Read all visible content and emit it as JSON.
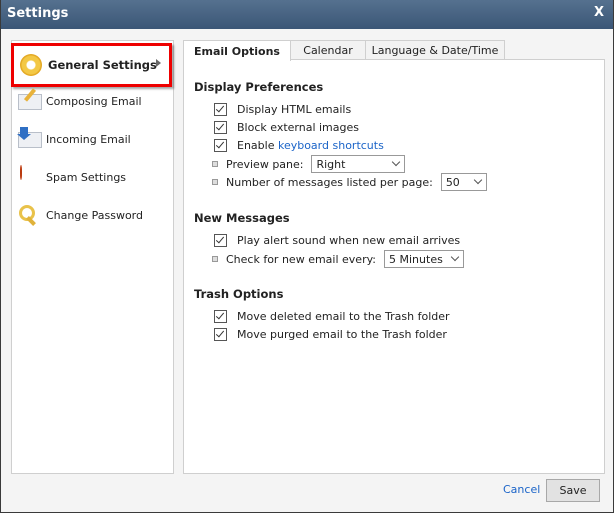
{
  "window": {
    "title": "Settings",
    "close_label": "X"
  },
  "sidebar": {
    "items": [
      {
        "label": "General Settings",
        "icon": "gear-icon",
        "active": true
      },
      {
        "label": "Composing Email",
        "icon": "envelope-pencil-icon"
      },
      {
        "label": "Incoming Email",
        "icon": "envelope-download-icon"
      },
      {
        "label": "Spam Settings",
        "icon": "no-entry-icon"
      },
      {
        "label": "Change Password",
        "icon": "key-icon"
      }
    ]
  },
  "tabs": [
    {
      "label": "Email Options",
      "active": true
    },
    {
      "label": "Calendar"
    },
    {
      "label": "Language & Date/Time"
    }
  ],
  "display_preferences": {
    "heading": "Display Preferences",
    "display_html": {
      "label": "Display HTML emails",
      "checked": true
    },
    "block_images": {
      "label": "Block external images",
      "checked": true
    },
    "keyboard_shortcuts": {
      "prefix": "Enable",
      "link": "keyboard shortcuts",
      "checked": true
    },
    "preview_pane": {
      "label": "Preview pane:",
      "value": "Right"
    },
    "messages_per_page": {
      "label": "Number of messages listed per page:",
      "value": "50"
    }
  },
  "new_messages": {
    "heading": "New Messages",
    "alert_sound": {
      "label": "Play alert sound when new email arrives",
      "checked": true
    },
    "check_every": {
      "label": "Check for new email every:",
      "value": "5 Minutes"
    }
  },
  "trash_options": {
    "heading": "Trash Options",
    "move_deleted": {
      "label": "Move deleted email to the Trash folder",
      "checked": true
    },
    "move_purged": {
      "label": "Move purged email to the Trash folder",
      "checked": true
    }
  },
  "footer": {
    "cancel_label": "Cancel",
    "save_label": "Save"
  }
}
